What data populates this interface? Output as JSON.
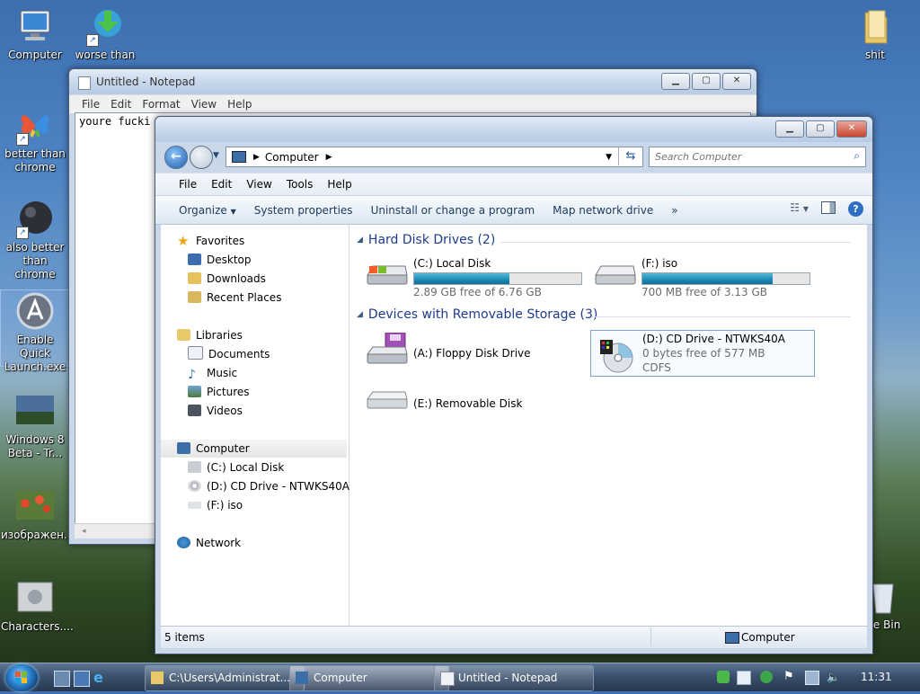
{
  "desktop": {
    "icons": [
      {
        "label": "Computer"
      },
      {
        "label": "worse than"
      },
      {
        "label": "better than chrome"
      },
      {
        "label": "also better than chrome"
      },
      {
        "label": "Enable Quick Launch.exe"
      },
      {
        "label": "Windows 8 Beta - Tr..."
      },
      {
        "label": "изображен..."
      },
      {
        "label": "Characters...."
      },
      {
        "label": "shit"
      },
      {
        "label": "cle Bin"
      }
    ]
  },
  "notepad": {
    "title": "Untitled - Notepad",
    "menu": [
      "File",
      "Edit",
      "Format",
      "View",
      "Help"
    ],
    "text": "youre fucki"
  },
  "explorer": {
    "address": {
      "crumb": "Computer"
    },
    "search": {
      "placeholder": "Search Computer"
    },
    "menu": [
      "File",
      "Edit",
      "View",
      "Tools",
      "Help"
    ],
    "commands": {
      "organize": "Organize",
      "system_properties": "System properties",
      "uninstall": "Uninstall or change a program",
      "map_drive": "Map network drive",
      "more": "»"
    },
    "nav": {
      "favorites": "Favorites",
      "desktop": "Desktop",
      "downloads": "Downloads",
      "recent": "Recent Places",
      "libraries": "Libraries",
      "documents": "Documents",
      "music": "Music",
      "pictures": "Pictures",
      "videos": "Videos",
      "computer": "Computer",
      "c_drive": "(C:) Local Disk",
      "d_drive": "(D:) CD Drive - NTWKS40A",
      "f_drive": "(F:) iso",
      "network": "Network"
    },
    "groups": {
      "hdd": "Hard Disk Drives (2)",
      "removable": "Devices with Removable Storage (3)"
    },
    "drives": {
      "c": {
        "name": "(C:) Local Disk",
        "free": "2.89 GB free of 6.76 GB",
        "used_fraction": 0.57
      },
      "f": {
        "name": "(F:) iso",
        "free": "700 MB free of 3.13 GB",
        "used_fraction": 0.78
      },
      "a": {
        "name": "(A:) Floppy Disk Drive"
      },
      "d": {
        "name": "(D:) CD Drive - NTWKS40A",
        "free": "0 bytes free of 577 MB",
        "fs": "CDFS"
      },
      "e": {
        "name": "(E:) Removable Disk"
      }
    },
    "status": {
      "items": "5 items",
      "location": "Computer"
    }
  },
  "taskbar": {
    "buttons": {
      "folder": "C:\\Users\\Administrat...",
      "computer": "Computer",
      "notepad": "Untitled - Notepad"
    },
    "clock": "11:31"
  }
}
